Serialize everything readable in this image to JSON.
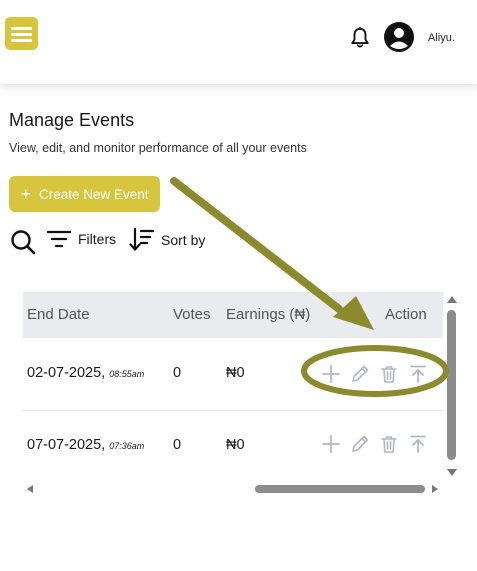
{
  "header": {
    "username": "Aliyu.",
    "icons": {
      "menu": "hamburger-menu-icon",
      "notifications": "bell-icon",
      "profile": "user-avatar-icon"
    }
  },
  "page": {
    "title": "Manage Events",
    "subtitle": "View, edit, and monitor performance of all your events",
    "create_button_plus": "+",
    "create_button_label": "Create New Event"
  },
  "toolbar": {
    "filters_label": "Filters",
    "sort_label": "Sort by"
  },
  "table": {
    "columns": {
      "end_date": "End Date",
      "votes": "Votes",
      "earnings": "Earnings (₦)",
      "action": "Action"
    },
    "rows": [
      {
        "date": "02-07-2025,",
        "time": "08:55am",
        "votes": "0",
        "earnings": "₦0"
      },
      {
        "date": "07-07-2025,",
        "time": "07:36am",
        "votes": "0",
        "earnings": "₦0"
      }
    ],
    "action_icons": [
      "plus-icon",
      "pencil-icon",
      "trash-icon",
      "upload-icon"
    ]
  },
  "colors": {
    "brand": "#d8c53e",
    "annotation": "#8b8a2c",
    "header_bg": "#e9ebef",
    "icon_muted": "#b0b8c4"
  }
}
